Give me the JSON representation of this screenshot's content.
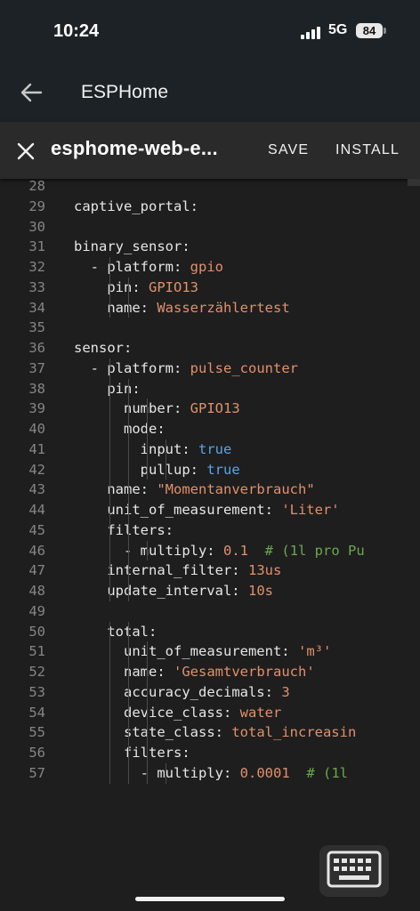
{
  "status": {
    "time": "10:24",
    "network": "5G",
    "battery": "84"
  },
  "appbar": {
    "title": "ESPHome",
    "back_icon": "arrow-left-icon"
  },
  "editor": {
    "filename": "esphome-web-e...",
    "save_label": "SAVE",
    "install_label": "INSTALL",
    "close_icon": "close-icon"
  },
  "code_lines": [
    {
      "n": "28",
      "t": ""
    },
    {
      "n": "29",
      "t": "captive_portal:"
    },
    {
      "n": "30",
      "t": ""
    },
    {
      "n": "31",
      "t": "binary_sensor:"
    },
    {
      "n": "32",
      "t": "  - platform: gpio"
    },
    {
      "n": "33",
      "t": "    pin: GPIO13"
    },
    {
      "n": "34",
      "t": "    name: Wasserzählertest"
    },
    {
      "n": "35",
      "t": ""
    },
    {
      "n": "36",
      "t": "sensor:"
    },
    {
      "n": "37",
      "t": "  - platform: pulse_counter"
    },
    {
      "n": "38",
      "t": "    pin:"
    },
    {
      "n": "39",
      "t": "      number: GPIO13"
    },
    {
      "n": "40",
      "t": "      mode:"
    },
    {
      "n": "41",
      "t": "        input: true"
    },
    {
      "n": "42",
      "t": "        pullup: true"
    },
    {
      "n": "43",
      "t": "    name: \"Momentanverbrauch\""
    },
    {
      "n": "44",
      "t": "    unit_of_measurement: 'Liter'"
    },
    {
      "n": "45",
      "t": "    filters:"
    },
    {
      "n": "46",
      "t": "      - multiply: 0.1  # (1l pro Pu"
    },
    {
      "n": "47",
      "t": "    internal_filter: 13us"
    },
    {
      "n": "48",
      "t": "    update_interval: 10s"
    },
    {
      "n": "49",
      "t": ""
    },
    {
      "n": "50",
      "t": "    total:"
    },
    {
      "n": "51",
      "t": "      unit_of_measurement: 'm³'"
    },
    {
      "n": "52",
      "t": "      name: 'Gesamtverbrauch'"
    },
    {
      "n": "53",
      "t": "      accuracy_decimals: 3"
    },
    {
      "n": "54",
      "t": "      device_class: water"
    },
    {
      "n": "55",
      "t": "      state_class: total_increasin"
    },
    {
      "n": "56",
      "t": "      filters:"
    },
    {
      "n": "57",
      "t": "        - multiply: 0.0001  # (1l"
    }
  ],
  "keyboard_icon": "keyboard-icon",
  "colors": {
    "string": "#e2906b",
    "boolean": "#5aa3e8",
    "comment": "#6aa84f",
    "line_number": "#858585"
  }
}
